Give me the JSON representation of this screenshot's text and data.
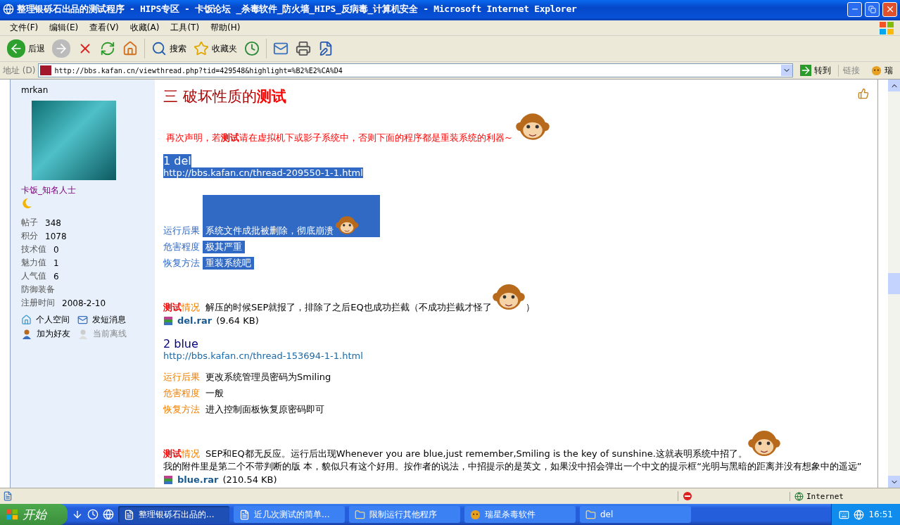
{
  "window": {
    "title": "整理银砾石出品的测试程序 - HIPS专区 - 卡饭论坛 _杀毒软件_防火墙_HIPS_反病毒_计算机安全 - Microsoft Internet Explorer"
  },
  "menu": [
    "文件(F)",
    "编辑(E)",
    "查看(V)",
    "收藏(A)",
    "工具(T)",
    "帮助(H)"
  ],
  "toolbar": [
    {
      "kind": "back",
      "label": "后退",
      "disabled": false
    },
    {
      "kind": "forward",
      "disabled": true
    },
    {
      "kind": "stop",
      "disabled": false
    },
    {
      "kind": "refresh",
      "disabled": false
    },
    {
      "kind": "home",
      "disabled": false
    },
    {
      "kind": "search",
      "label": "搜索",
      "disabled": false
    },
    {
      "kind": "favorites",
      "label": "收藏夹",
      "disabled": false
    },
    {
      "kind": "history",
      "disabled": false
    },
    {
      "kind": "mail",
      "disabled": false
    },
    {
      "kind": "print",
      "disabled": false
    },
    {
      "kind": "edit",
      "disabled": false
    }
  ],
  "address_bar": {
    "label": "地址 (D)",
    "value": "http://bbs.kafan.cn/viewthread.php?tid=429548&highlight=%B2%E2%CA%D4",
    "go": "转到",
    "links": "链接",
    "addon": "瑞"
  },
  "sidebar": {
    "username": "mrkan",
    "rank": "卡饭_知名人士",
    "stats": [
      {
        "label": "帖子",
        "value": "348"
      },
      {
        "label": "积分",
        "value": "1078"
      },
      {
        "label": "技术值",
        "value": "0"
      },
      {
        "label": "魅力值",
        "value": "1"
      },
      {
        "label": "人气值",
        "value": "6"
      },
      {
        "label": "防御装备"
      },
      {
        "label": "注册时间",
        "value": "2008-2-10"
      }
    ],
    "actions": [
      {
        "kind": "home",
        "label": "个人空间",
        "disabled": false
      },
      {
        "kind": "message",
        "label": "发短消息",
        "disabled": false
      },
      {
        "kind": "friend",
        "label": "加为好友",
        "disabled": false
      },
      {
        "kind": "offline",
        "label": "当前离线",
        "disabled": true
      }
    ]
  },
  "post": {
    "heading": "三  破坏性质的**测试**",
    "notice": "再次声明，若**测试**请在虚拟机下或影子系统中，否则下面的程序都是重装系统的利器~",
    "sections": [
      {
        "title": "1 del",
        "link": "http://bbs.kafan.cn/thread-209550-1-1.html",
        "selected": true,
        "fields": [
          {
            "label": "运行后果",
            "value": "系统文件成批被删除，彻底崩溃",
            "emoticon": true
          },
          {
            "label": "危害程度",
            "value": "极其严重"
          },
          {
            "label": "恢复方法",
            "value": "重装系统吧"
          }
        ],
        "test_label": "**测试**情况",
        "test_parts": [
          {
            "kind": "text",
            "text": "解压的时候SEP就报了，排除了之后EQ也成功拦截（不成功拦截才怪了"
          },
          {
            "kind": "emoticon"
          },
          {
            "kind": "text",
            "text": "）"
          }
        ],
        "attachment": {
          "name": "del.rar",
          "size": "(9.64 KB)"
        }
      },
      {
        "title": "2 blue",
        "link": "http://bbs.kafan.cn/thread-153694-1-1.html",
        "selected": false,
        "fields": [
          {
            "label": "运行后果",
            "value": "更改系统管理员密码为Smiling"
          },
          {
            "label": "危害程度",
            "value": "一般"
          },
          {
            "label": "恢复方法",
            "value": "进入控制面板恢复原密码即可"
          }
        ],
        "test_label": "**测试**情况",
        "test_parts": [
          {
            "kind": "text",
            "text": "SEP和EQ都无反应。运行后出现Whenever you are blue,just remember,Smiling is the key of sunshine.这就表明系统中招了。"
          },
          {
            "kind": "emoticon"
          },
          {
            "kind": "text",
            "text": "我的附件里是第二个不带判断的版 本，貌似只有这个好用。按作者的说法，中招提示的是英文，如果没中招会弹出一个中文的提示框“光明与黑暗的距离并没有想象中的遥远”"
          }
        ],
        "attachment": {
          "name": "blue.rar",
          "size": "(210.54 KB)"
        }
      }
    ]
  },
  "status_bar": {
    "zone": "Internet"
  },
  "taskbar": {
    "start": "开始",
    "tasks": [
      {
        "kind": "ie",
        "label": "整理银砾石出品的...",
        "selected": true
      },
      {
        "kind": "ie",
        "label": "近几次测试的简单...",
        "selected": false
      },
      {
        "kind": "folder",
        "label": "限制运行其他程序",
        "selected": false
      },
      {
        "kind": "tiger",
        "label": "瑞星杀毒软件",
        "selected": false
      },
      {
        "kind": "folder",
        "label": "del",
        "selected": false
      }
    ],
    "time": "16:51"
  }
}
